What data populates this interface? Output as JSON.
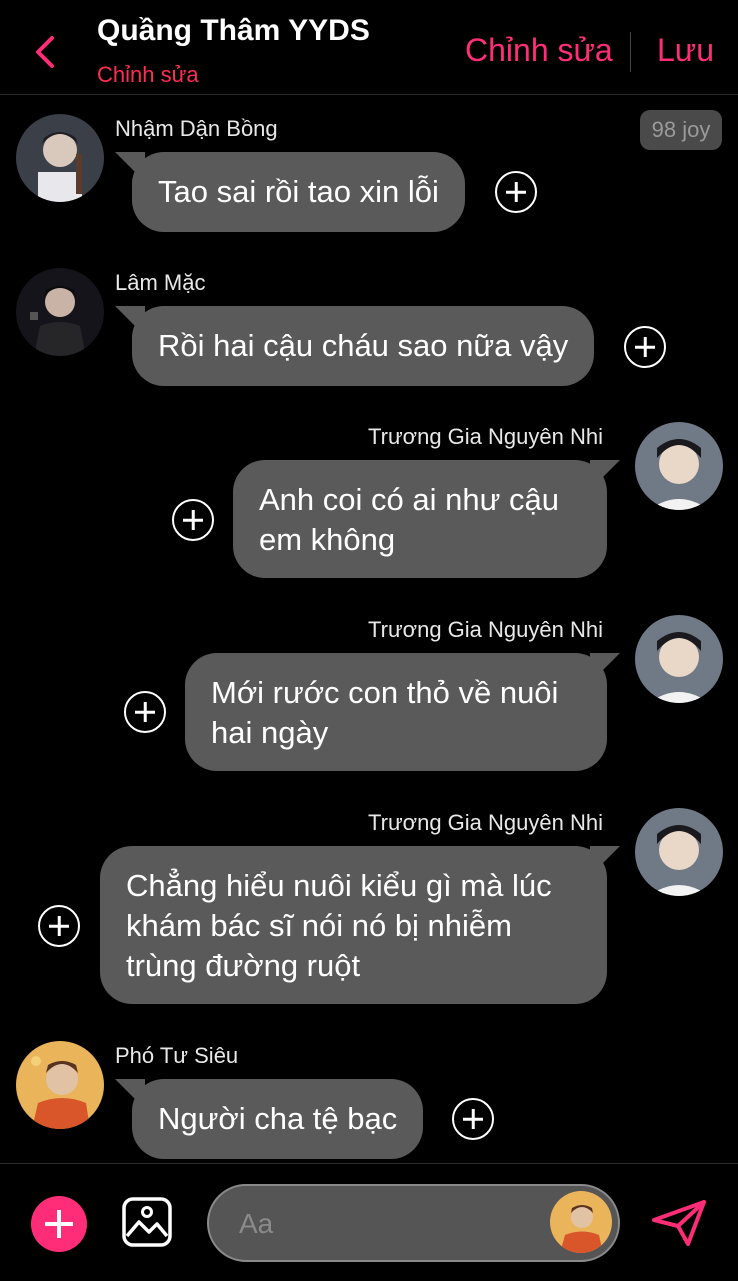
{
  "header": {
    "title": "Quầng Thâm YYDS",
    "subtitle": "Chỉnh sửa",
    "edit_label": "Chỉnh sửa",
    "save_label": "Lưu"
  },
  "badge": "98 joy",
  "messages": [
    {
      "sender": "Nhậm Dận Bồng",
      "text": "Tao sai rồi tao xin lỗi",
      "side": "left"
    },
    {
      "sender": "Lâm Mặc",
      "text": "Rồi hai cậu cháu sao nữa vậy",
      "side": "left"
    },
    {
      "sender": "Trương Gia Nguyên Nhi",
      "lines": [
        "Anh coi có ai như cậu",
        "em không"
      ],
      "side": "right"
    },
    {
      "sender": "Trương Gia Nguyên Nhi",
      "lines": [
        "Mới rước con thỏ về nuôi",
        "hai ngày"
      ],
      "side": "right"
    },
    {
      "sender": "Trương Gia Nguyên Nhi",
      "lines": [
        "Chẳng hiểu nuôi kiểu gì mà lúc",
        "khám bác sĩ nói nó bị nhiễm",
        "trùng đường ruột"
      ],
      "side": "right"
    },
    {
      "sender": "Phó Tư Siêu",
      "text": "Người cha tệ bạc",
      "side": "left"
    }
  ],
  "composer": {
    "placeholder": "Aa"
  },
  "colors": {
    "accent": "#ff2d78",
    "bubble": "#5a5a5a",
    "background": "#000000"
  },
  "icons": [
    "back-chevron-icon",
    "plus-circle-icon",
    "add-icon",
    "image-icon",
    "send-icon"
  ]
}
